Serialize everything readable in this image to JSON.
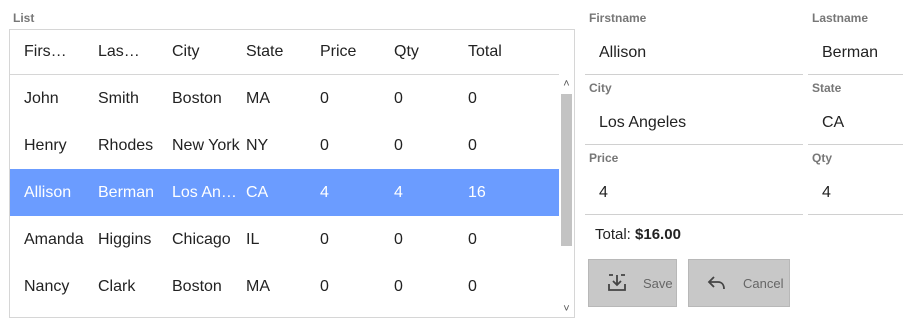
{
  "list": {
    "label": "List",
    "columns": [
      "Firs…",
      "Las…",
      "City",
      "State",
      "Price",
      "Qty",
      "Total"
    ],
    "rows": [
      [
        "John",
        "Smith",
        "Boston",
        "MA",
        "0",
        "0",
        "0"
      ],
      [
        "Henry",
        "Rhodes",
        "New York",
        "NY",
        "0",
        "0",
        "0"
      ],
      [
        "Allison",
        "Berman",
        "Los An…",
        "CA",
        "4",
        "4",
        "16"
      ],
      [
        "Amanda",
        "Higgins",
        "Chicago",
        "IL",
        "0",
        "0",
        "0"
      ],
      [
        "Nancy",
        "Clark",
        "Boston",
        "MA",
        "0",
        "0",
        "0"
      ]
    ],
    "selected_index": 2,
    "scroll_up_glyph": "˄",
    "scroll_down_glyph": "˅"
  },
  "form": {
    "firstname_label": "Firstname",
    "firstname_value": "Allison",
    "lastname_label": "Lastname",
    "lastname_value": "Berman",
    "city_label": "City",
    "city_value": "Los Angeles",
    "state_label": "State",
    "state_value": "CA",
    "price_label": "Price",
    "price_value": "4",
    "qty_label": "Qty",
    "qty_value": "4",
    "total_label": "Total:",
    "total_value": "$16.00"
  },
  "buttons": {
    "save_label": "Save",
    "save_icon": "save-tray-icon",
    "cancel_label": "Cancel",
    "cancel_icon": "undo-arrow-icon"
  },
  "colors": {
    "selected_row": "#6b9cff",
    "button_bg": "#c8c8c8",
    "label_gray": "#777777"
  }
}
